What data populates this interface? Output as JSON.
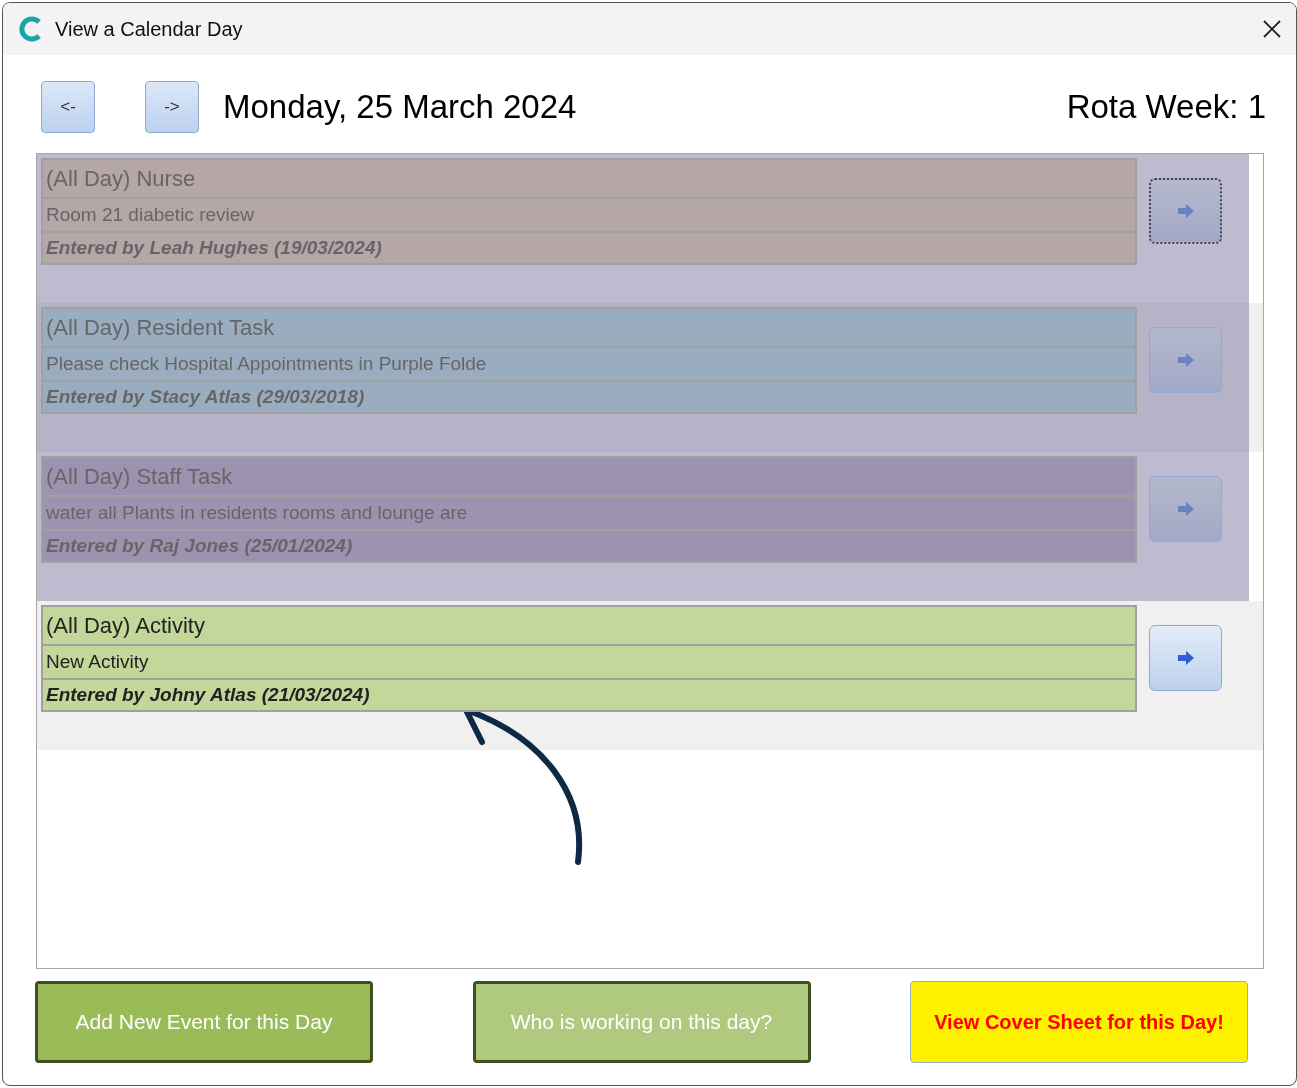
{
  "window": {
    "title": "View a Calendar Day"
  },
  "nav": {
    "prev": "<-",
    "next": "->",
    "date": "Monday, 25 March 2024",
    "rota_week": "Rota Week: 1"
  },
  "events": [
    {
      "title": "(All Day) Nurse",
      "description": "Room 21 diabetic review",
      "entered_by": "Entered by Leah Hughes (19/03/2024)",
      "color": "#b5a6a8",
      "dimmed": true,
      "focused": true
    },
    {
      "title": "(All Day) Resident Task",
      "description": "Please check Hospital Appointments in Purple Folde",
      "entered_by": "Entered by Stacy Atlas (29/03/2018)",
      "color": "#9aadc0",
      "dimmed": true,
      "focused": false
    },
    {
      "title": "(All Day) Staff Task",
      "description": "water all Plants in residents rooms and lounge are",
      "entered_by": "Entered by Raj Jones (25/01/2024)",
      "color": "#9d93b1",
      "dimmed": true,
      "focused": false
    },
    {
      "title": "(All Day) Activity",
      "description": "New Activity",
      "entered_by": "Entered by Johny Atlas (21/03/2024)",
      "color": "#c4d79b",
      "dimmed": false,
      "focused": false
    }
  ],
  "buttons": [
    {
      "label": "Add New Event for this Day",
      "kind": "primary"
    },
    {
      "label": "Who is working on this day?",
      "kind": "secondary"
    },
    {
      "label": "View Cover Sheet for this Day!",
      "kind": "highlight"
    }
  ]
}
